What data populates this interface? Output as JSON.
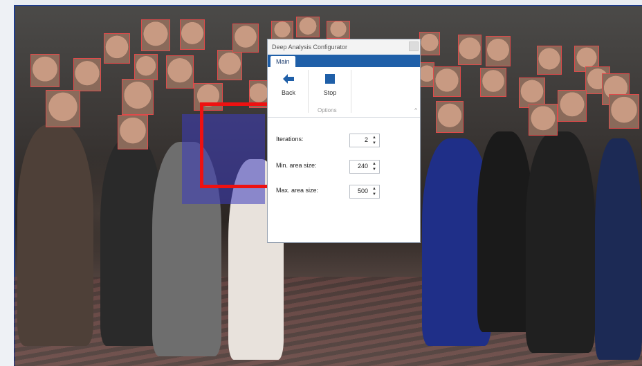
{
  "dialog": {
    "title": "Deep Analysis Configurator",
    "tab_main": "Main",
    "back_label": "Back",
    "stop_label": "Stop",
    "group_options": "Options",
    "fields": [
      {
        "label": "Iterations:",
        "value": "2"
      },
      {
        "label": "Min. area size:",
        "value": "240"
      },
      {
        "label": "Max. area size:",
        "value": "500"
      }
    ]
  },
  "icons": {
    "back": "arrow-left-icon",
    "stop": "stop-square-icon",
    "spin": "spin-up-down-icon"
  },
  "colors": {
    "accent": "#1f5fa8",
    "face_box": "#e04a4a",
    "selection": "#ee1111"
  }
}
